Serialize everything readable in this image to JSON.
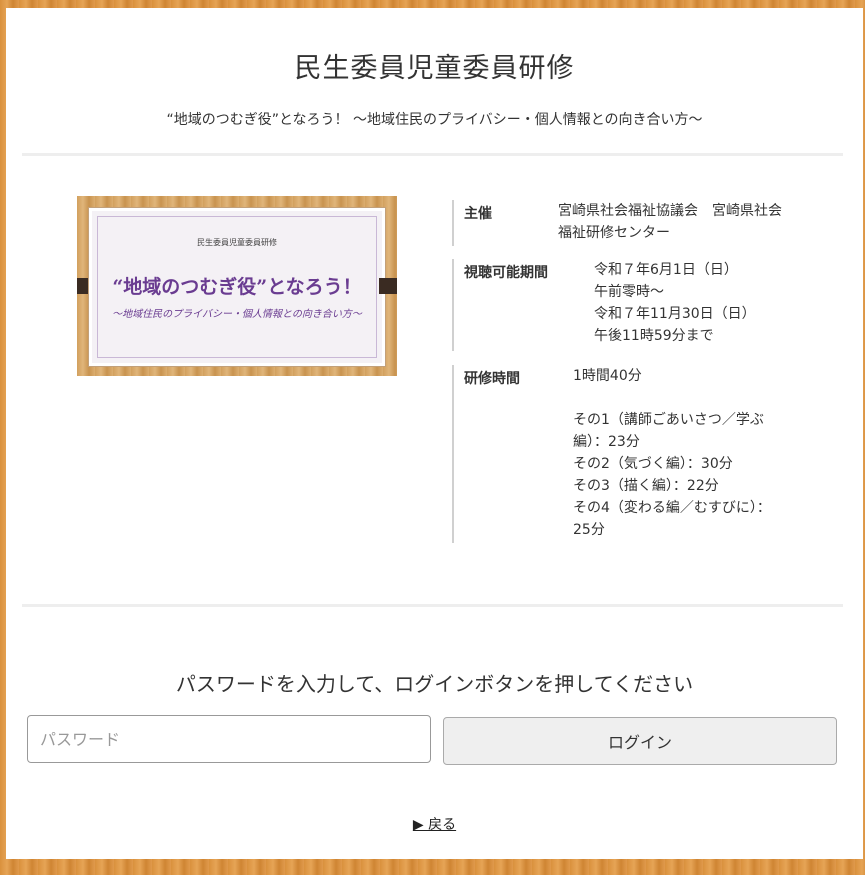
{
  "header": {
    "title": "民生委員児童委員研修",
    "subtitle": "“地域のつむぎ役”となろう！ ～地域住民のプライバシー・個人情報との向き合い方～"
  },
  "thumbnail": {
    "small_text": "民生委員児童委員研修",
    "main_text": "“地域のつむぎ役”となろう！",
    "sub_text": "～地域住民のプライバシー・個人情報との向き合い方～"
  },
  "details": {
    "organizer": {
      "label": "主催",
      "lines": [
        "宮崎県社会福祉協議会　宮崎県社会",
        "福祉研修センター"
      ]
    },
    "viewing_period": {
      "label": "視聴可能期間",
      "lines": [
        "令和７年6月1日（日）",
        "午前零時～",
        "令和７年11月30日（日）",
        "午後11時59分まで"
      ]
    },
    "training_time": {
      "label": "研修時間",
      "lines": [
        "1時間40分",
        "",
        "その1（講師ごあいさつ／学ぶ",
        "編）：23分",
        "その2（気づく編）：30分",
        "その3（描く編）：22分",
        "その4（変わる編／むすびに）：",
        "25分"
      ]
    }
  },
  "login": {
    "prompt": "パスワードを入力して、ログインボタンを押してください",
    "password_placeholder": "パスワード",
    "password_value": "",
    "button_label": "ログイン"
  },
  "back_link": {
    "label": "▶ 戻る"
  },
  "colors": {
    "wood": "#d9913d",
    "card_bg": "#ffffff",
    "title_purple": "#6a3c91",
    "button_bg": "#efefef"
  }
}
